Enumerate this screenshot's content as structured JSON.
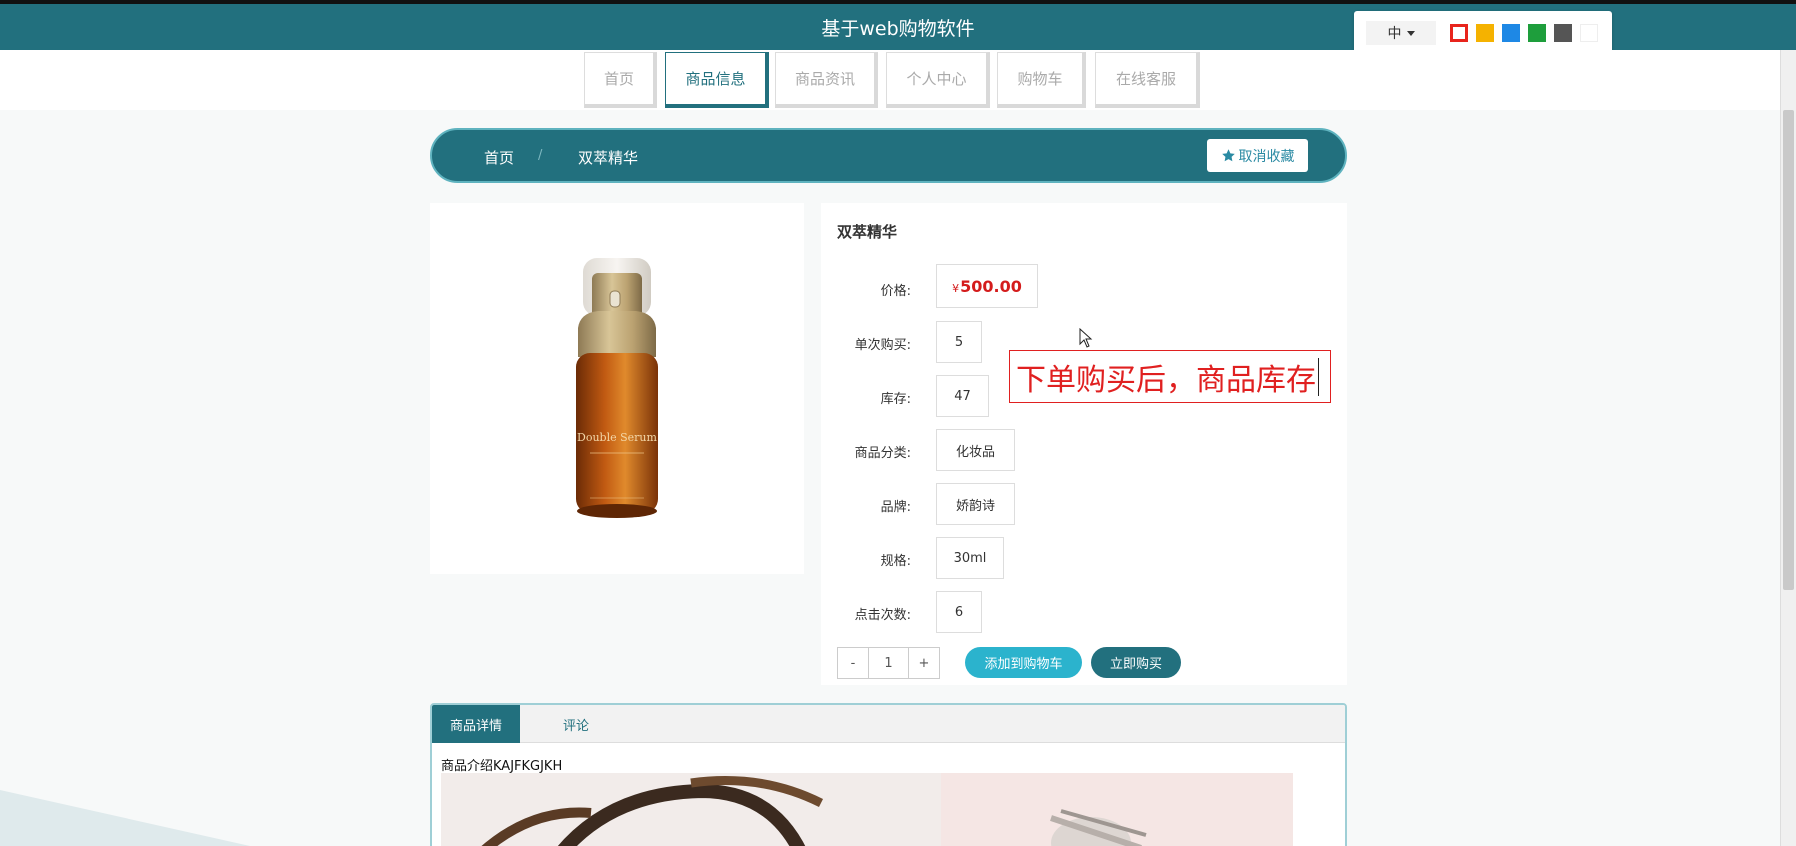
{
  "header": {
    "title": "基于web购物软件"
  },
  "theme_panel": {
    "language": "中",
    "swatches": [
      {
        "name": "red",
        "color": "#e8241c"
      },
      {
        "name": "amber",
        "color": "#f5b200"
      },
      {
        "name": "blue",
        "color": "#1e88e5"
      },
      {
        "name": "green",
        "color": "#1e9e3c"
      },
      {
        "name": "dark-gray",
        "color": "#555555"
      },
      {
        "name": "white",
        "color": "#ffffff"
      }
    ]
  },
  "nav": {
    "items": [
      {
        "label": "首页"
      },
      {
        "label": "商品信息"
      },
      {
        "label": "商品资讯"
      },
      {
        "label": "个人中心"
      },
      {
        "label": "购物车"
      },
      {
        "label": "在线客服"
      }
    ],
    "active_index": 1
  },
  "breadcrumb": {
    "home": "首页",
    "separator": "/",
    "current": "双萃精华"
  },
  "favorite_button": {
    "label": "取消收藏"
  },
  "product": {
    "name": "双萃精华",
    "price_label": "价格:",
    "currency": "¥",
    "price": "500.00",
    "fields": [
      {
        "label": "单次购买:",
        "value": "5"
      },
      {
        "label": "库存:",
        "value": "47"
      },
      {
        "label": "商品分类:",
        "value": "化妆品"
      },
      {
        "label": "品牌:",
        "value": "娇韵诗"
      },
      {
        "label": "规格:",
        "value": "30ml"
      },
      {
        "label": "点击次数:",
        "value": "6"
      }
    ],
    "bottle_text": "Double Serum"
  },
  "quantity": {
    "minus": "-",
    "value": "1",
    "plus": "+"
  },
  "actions": {
    "add_to_cart": "添加到购物车",
    "buy_now": "立即购买"
  },
  "annotation": {
    "text": "下单购买后，商品库存"
  },
  "tabs": [
    {
      "label": "商品详情"
    },
    {
      "label": "评论"
    }
  ],
  "detail": {
    "intro": "商品介绍KAJFKGJKH"
  },
  "colors": {
    "primary": "#22707e",
    "accent": "#2bb3cd",
    "price": "#d41c1c",
    "annotation": "#e02020"
  }
}
